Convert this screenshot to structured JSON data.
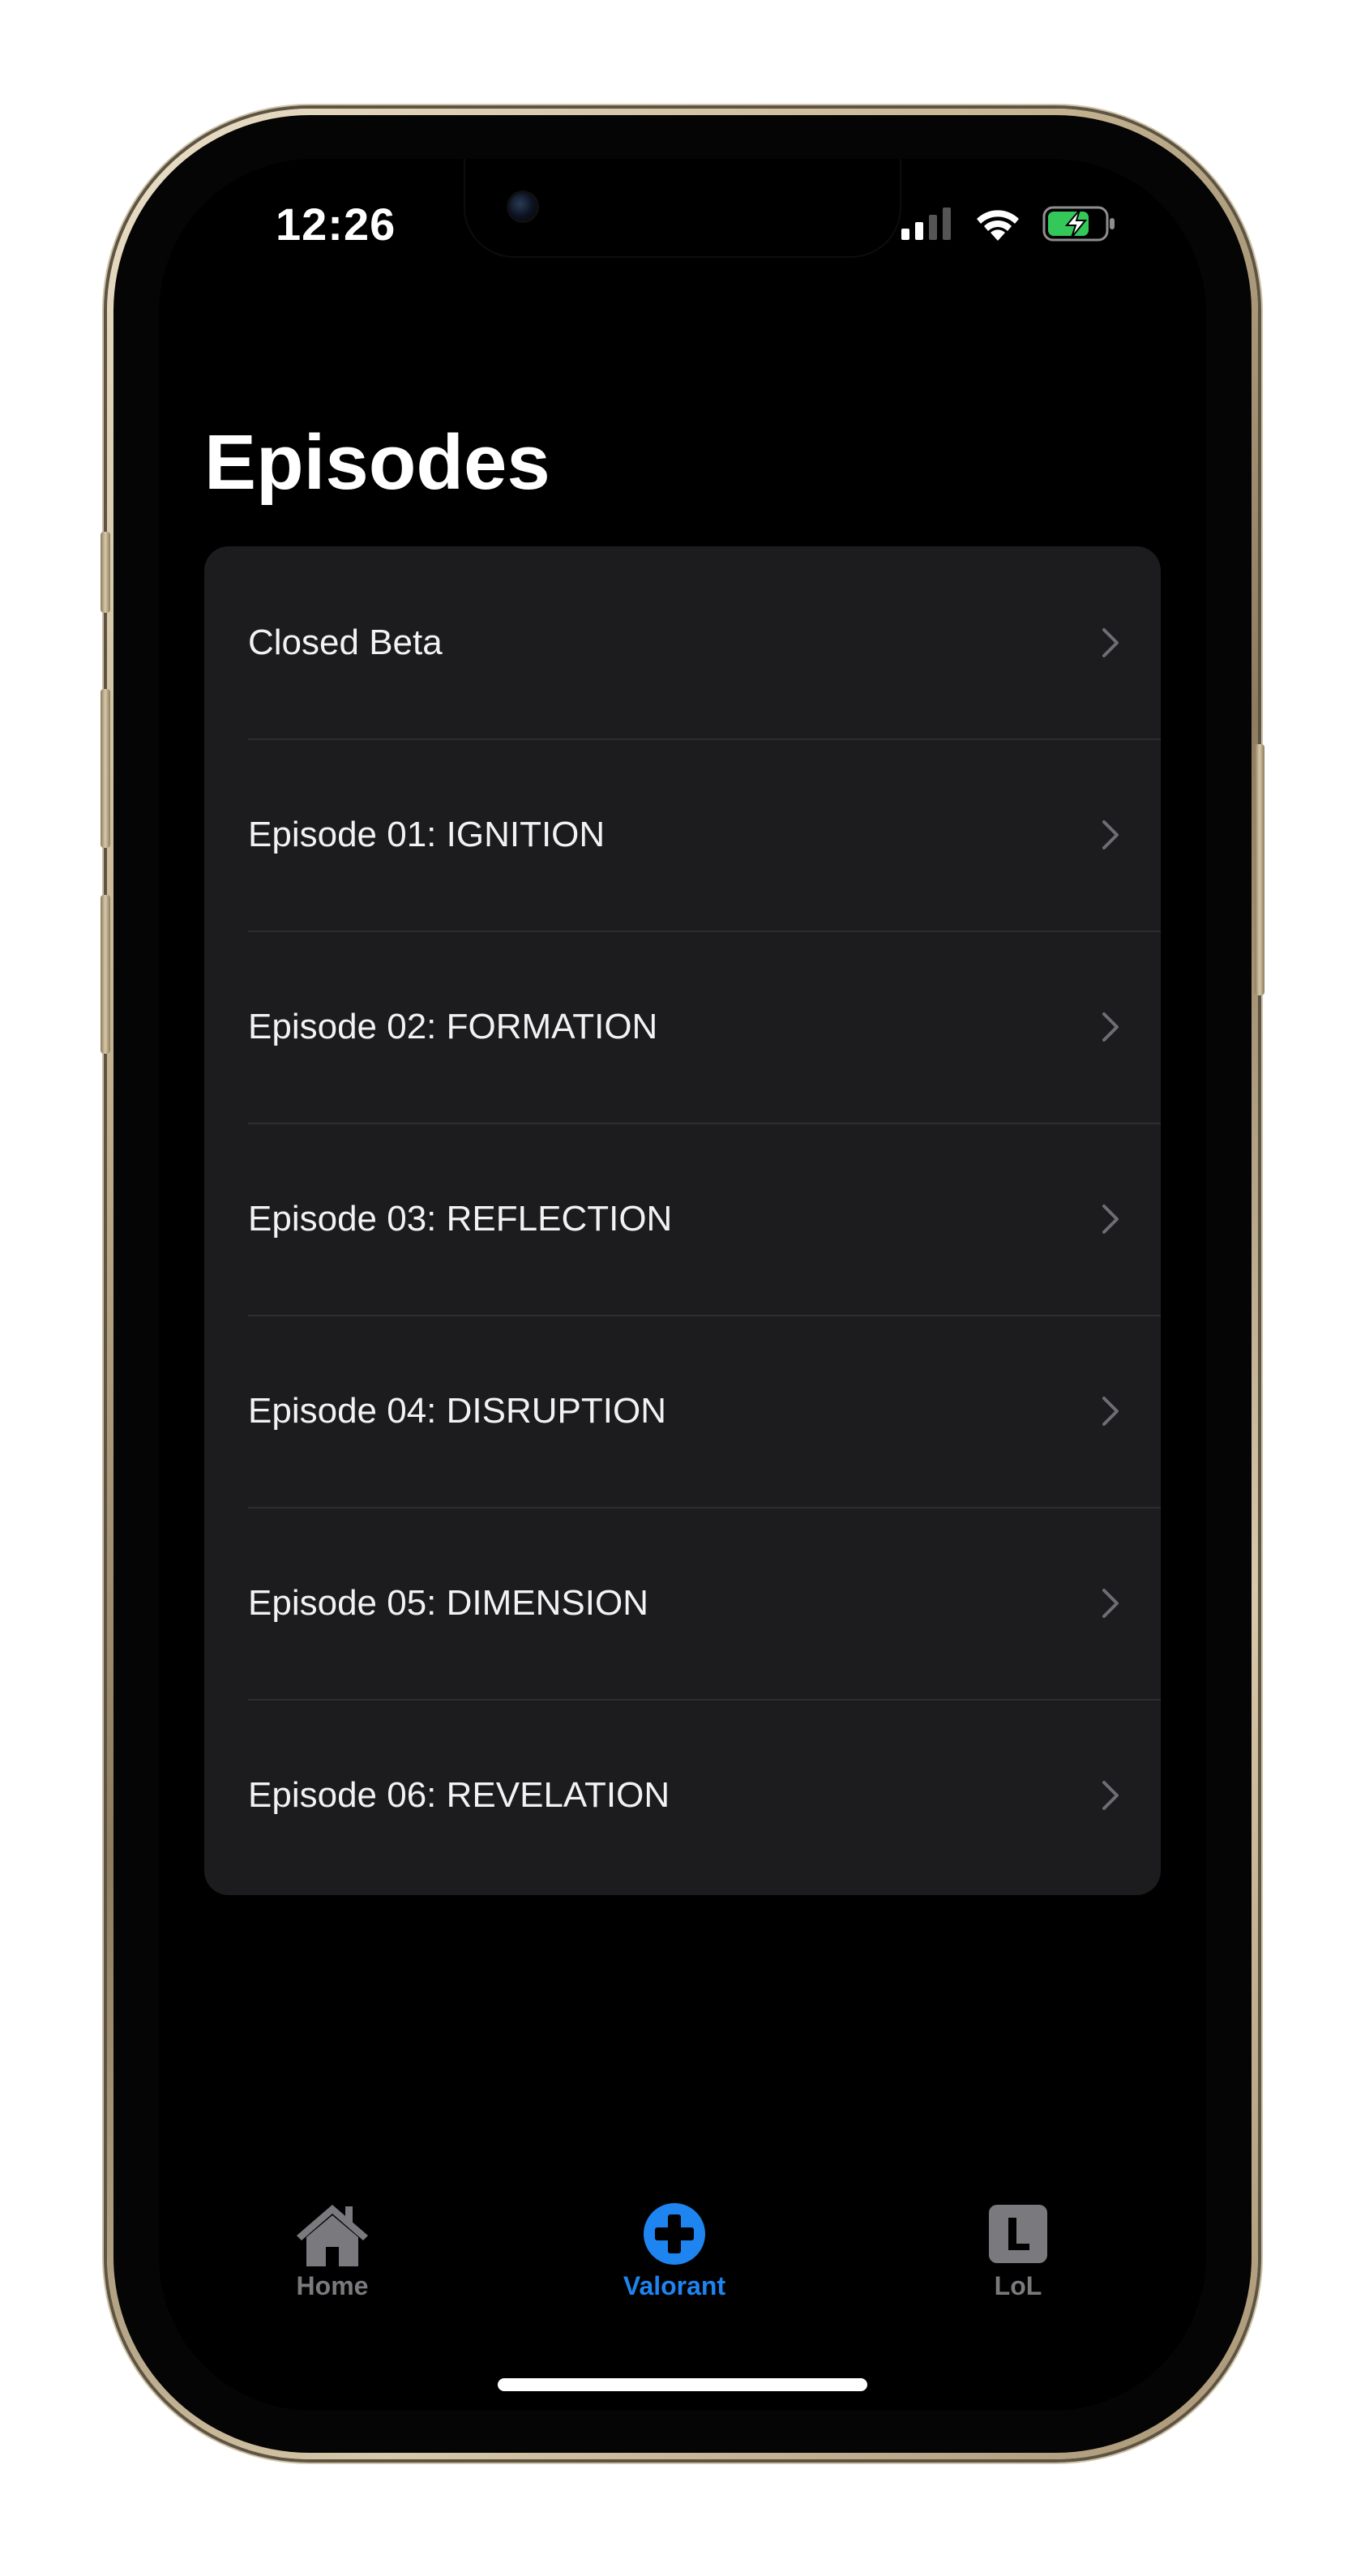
{
  "status_bar": {
    "time": "12:26",
    "icons": [
      "signal-icon",
      "wifi-icon",
      "battery-charging-icon"
    ],
    "battery_color": "#34c759"
  },
  "page": {
    "title": "Episodes"
  },
  "episodes": [
    {
      "label": "Closed Beta"
    },
    {
      "label": "Episode 01: IGNITION"
    },
    {
      "label": "Episode 02: FORMATION"
    },
    {
      "label": "Episode 03: REFLECTION"
    },
    {
      "label": "Episode 04: DISRUPTION"
    },
    {
      "label": "Episode 05: DIMENSION"
    },
    {
      "label": "Episode 06: REVELATION"
    }
  ],
  "tab_bar": {
    "tabs": [
      {
        "label": "Home",
        "icon": "house-icon",
        "active": false
      },
      {
        "label": "Valorant",
        "icon": "plus-circle-icon",
        "active": true
      },
      {
        "label": "LoL",
        "icon": "l-square-icon",
        "active": false
      }
    ],
    "active_color": "#1e84f0",
    "inactive_color": "#7a7a7e"
  }
}
